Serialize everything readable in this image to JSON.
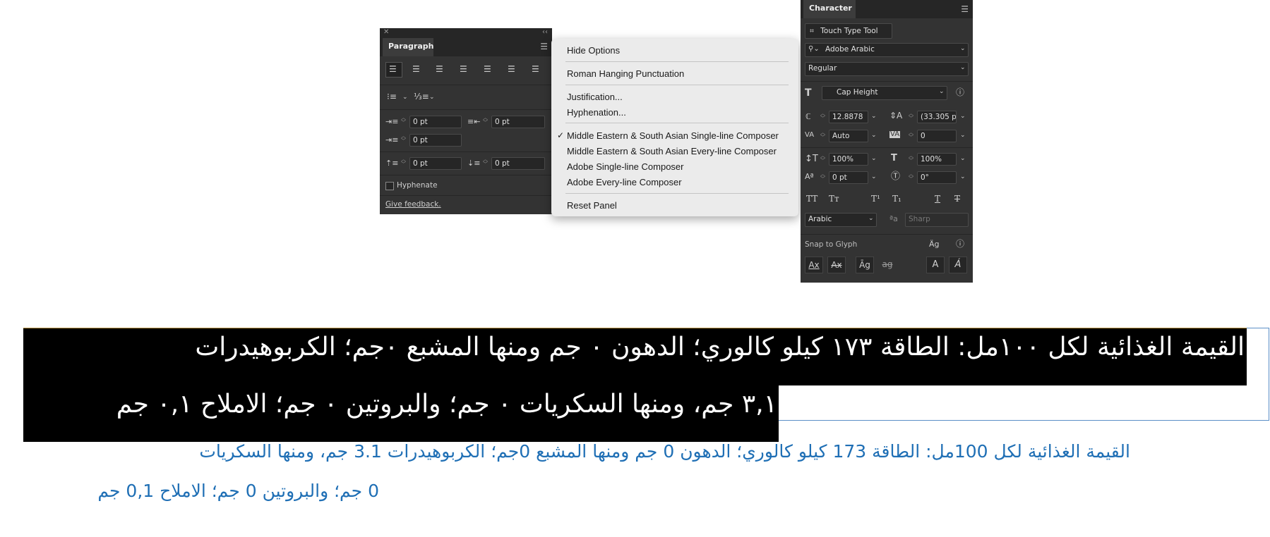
{
  "paragraph_panel": {
    "tab_label": "Paragraph",
    "indent_left": "0 pt",
    "indent_right": "0 pt",
    "first_line_indent": "0 pt",
    "space_before": "0 pt",
    "space_after": "0 pt",
    "hyphenate_label": "Hyphenate",
    "hyphenate_checked": false,
    "feedback_link": "Give feedback."
  },
  "flyout_menu": {
    "items": [
      "Hide Options",
      "Roman Hanging Punctuation",
      "Justification...",
      "Hyphenation...",
      "Middle Eastern & South Asian Single-line Composer",
      "Middle Eastern & South Asian Every-line Composer",
      "Adobe Single-line Composer",
      "Adobe Every-line Composer",
      "Reset Panel"
    ],
    "checked_item": "Middle Eastern & South Asian Single-line Composer",
    "checkmark": "✓"
  },
  "character_panel": {
    "tab_label": "Character",
    "touch_type_label": "Touch Type Tool",
    "font_family": "Adobe Arabic",
    "font_style": "Regular",
    "size_reference": "Cap Height",
    "font_size": "12.8878",
    "leading": "(33.305 p",
    "kerning": "Auto",
    "tracking": "0",
    "vertical_scale": "100%",
    "horizontal_scale": "100%",
    "baseline_shift": "0 pt",
    "rotation": "0°",
    "language": "Arabic",
    "anti_aliasing_glyph": "ªa",
    "anti_aliasing": "Sharp",
    "snap_to_glyph_label": "Snap to Glyph",
    "case_buttons": [
      "TT",
      "Tт",
      "T¹",
      "T₁",
      "T",
      "T"
    ]
  },
  "text_frame": {
    "black_line_1": "القيمة الغذائية لكل ١٠٠مل: الطاقة ١٧٣ كيلو كالوري؛ الدهون ٠ جم ومنها المشبع ٠جم؛ الكربوهيدرات",
    "black_line_2": "٣,١ جم، ومنها السكريات ٠ جم؛ والبروتين ٠ جم؛ الاملاح ٠,١ جم",
    "blue_line_1": "القيمة الغذائية لكل 100مل: الطاقة 173 كيلو كالوري؛ الدهون 0 جم ومنها المشبع 0جم؛ الكربوهيدرات 3.1 جم، ومنها السكريات",
    "blue_line_2": "0 جم؛ والبروتين 0 جم؛ الاملاح 0,1 جم"
  },
  "colors": {
    "panel_bg": "#333333",
    "text_highlight": "#000000",
    "blue_text": "#1f6fb5",
    "frame_border": "#5b8fc7"
  }
}
